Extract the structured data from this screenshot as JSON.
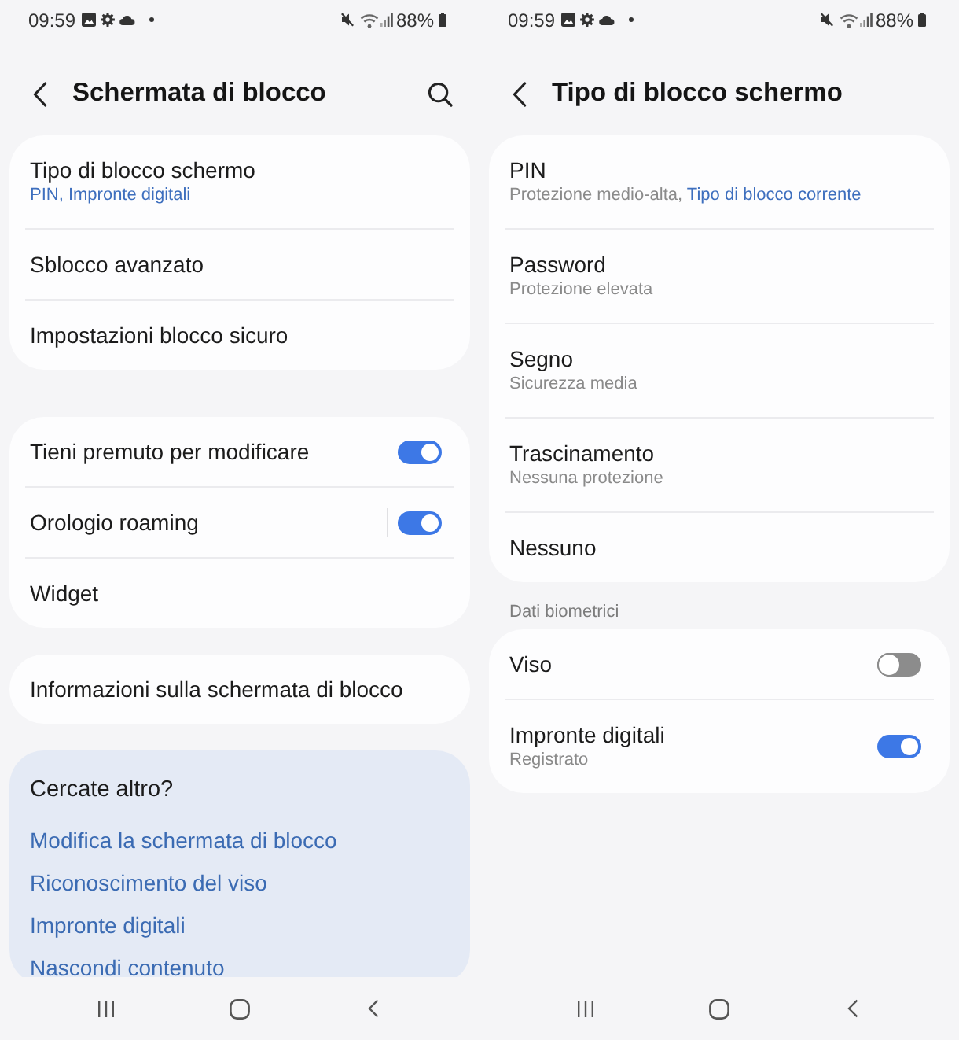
{
  "screens": [
    {
      "status_bar": {
        "time": "09:59",
        "battery": "88%"
      },
      "header": {
        "title": "Schermata di blocco",
        "search": true
      },
      "sections": [
        {
          "items": [
            {
              "kind": "link",
              "label": "Tipo di blocco schermo",
              "subtitle": [
                {
                  "text": "PIN, Impronte digitali",
                  "accent": true
                }
              ]
            },
            {
              "kind": "link",
              "label": "Sblocco avanzato"
            },
            {
              "kind": "link",
              "label": "Impostazioni blocco sicuro"
            }
          ]
        },
        {
          "items": [
            {
              "kind": "switch",
              "label": "Tieni premuto per modificare",
              "on": true
            },
            {
              "kind": "split_switch",
              "label": "Orologio roaming",
              "on": true
            },
            {
              "kind": "link",
              "label": "Widget"
            }
          ]
        },
        {
          "items": [
            {
              "kind": "link",
              "label": "Informazioni sulla schermata di blocco"
            }
          ]
        }
      ],
      "suggestions": {
        "title": "Cercate altro?",
        "links": [
          "Modifica la schermata di blocco",
          "Riconoscimento del viso",
          "Impronte digitali",
          "Nascondi contenuto"
        ]
      }
    },
    {
      "status_bar": {
        "time": "09:59",
        "battery": "88%"
      },
      "header": {
        "title": "Tipo di blocco schermo"
      },
      "sections": [
        {
          "items": [
            {
              "kind": "link",
              "label": "PIN",
              "subtitle": [
                {
                  "text": "Protezione medio-alta,",
                  "accent": false
                },
                {
                  "text": "Tipo di blocco corrente",
                  "accent": true
                }
              ]
            },
            {
              "kind": "link",
              "label": "Password",
              "subtitle": [
                {
                  "text": "Protezione elevata",
                  "accent": false
                }
              ]
            },
            {
              "kind": "link",
              "label": "Segno",
              "subtitle": [
                {
                  "text": "Sicurezza media",
                  "accent": false
                }
              ]
            },
            {
              "kind": "link",
              "label": "Trascinamento",
              "subtitle": [
                {
                  "text": "Nessuna protezione",
                  "accent": false
                }
              ]
            },
            {
              "kind": "link",
              "label": "Nessuno"
            }
          ]
        },
        {
          "heading": "Dati biometrici",
          "items": [
            {
              "kind": "switch",
              "label": "Viso",
              "on": false
            },
            {
              "kind": "switch",
              "label": "Impronte digitali",
              "on": true,
              "subtitle": [
                {
                  "text": "Registrato",
                  "accent": false
                }
              ]
            }
          ]
        }
      ]
    }
  ]
}
